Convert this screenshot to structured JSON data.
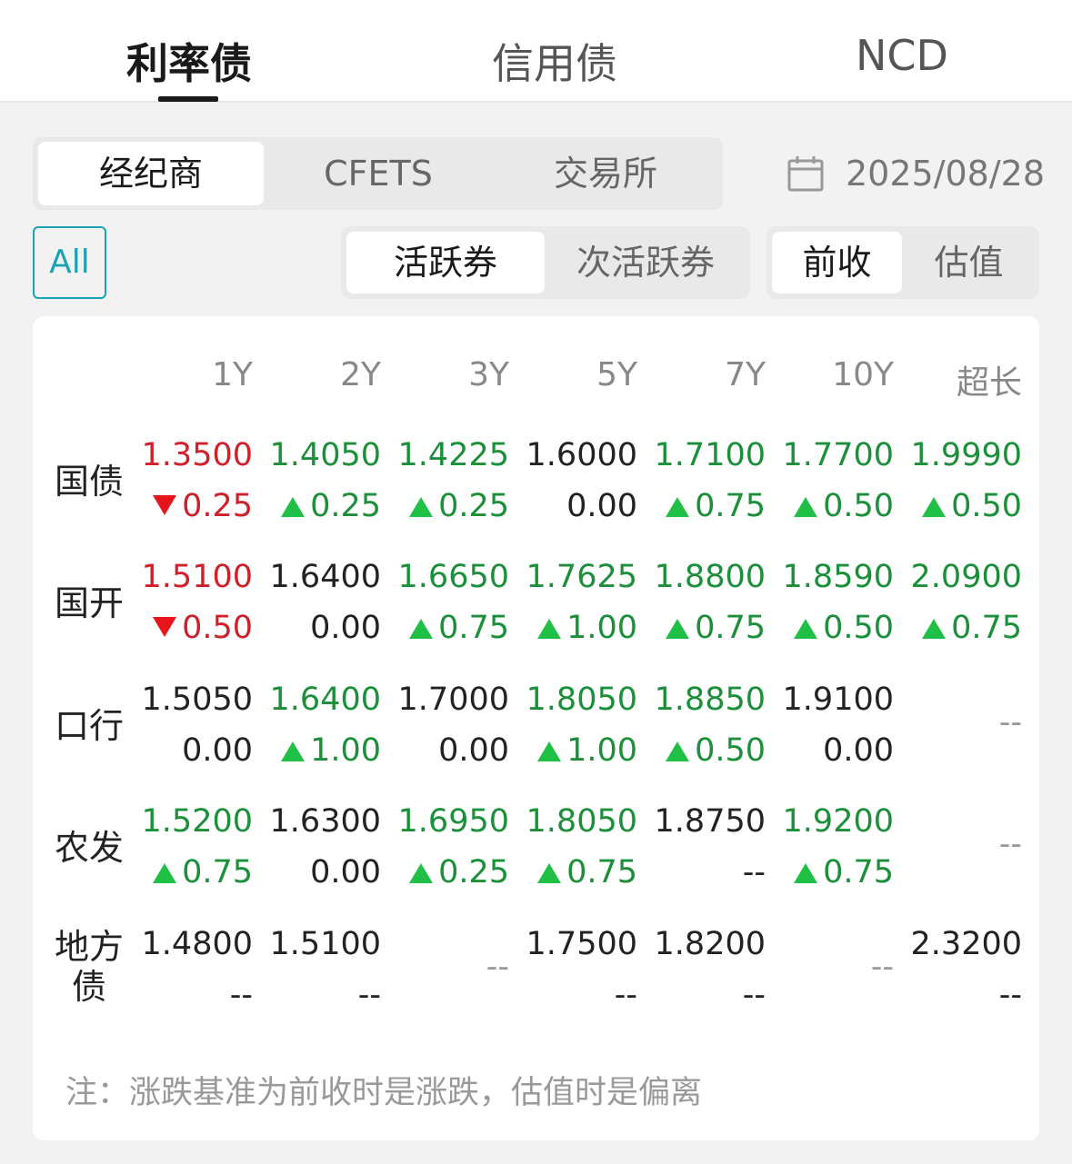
{
  "top_tabs": [
    {
      "label": "利率债",
      "active": true
    },
    {
      "label": "信用债",
      "active": false
    },
    {
      "label": "NCD",
      "active": false
    }
  ],
  "source_tabs": [
    {
      "label": "经纪商",
      "active": true
    },
    {
      "label": "CFETS",
      "active": false
    },
    {
      "label": "交易所",
      "active": false
    }
  ],
  "date": "2025/08/28",
  "all_label": "All",
  "bond_tabs": [
    {
      "label": "活跃券",
      "active": true
    },
    {
      "label": "次活跃券",
      "active": false
    }
  ],
  "basis_tabs": [
    {
      "label": "前收",
      "active": true
    },
    {
      "label": "估值",
      "active": false
    }
  ],
  "columns": [
    "1Y",
    "2Y",
    "3Y",
    "5Y",
    "7Y",
    "10Y",
    "超长"
  ],
  "rows": [
    {
      "label": "国债",
      "cells": [
        {
          "value": "1.3500",
          "change": "0.25",
          "dir": "down"
        },
        {
          "value": "1.4050",
          "change": "0.25",
          "dir": "up"
        },
        {
          "value": "1.4225",
          "change": "0.25",
          "dir": "up"
        },
        {
          "value": "1.6000",
          "change": "0.00",
          "dir": "flat"
        },
        {
          "value": "1.7100",
          "change": "0.75",
          "dir": "up"
        },
        {
          "value": "1.7700",
          "change": "0.50",
          "dir": "up"
        },
        {
          "value": "1.9990",
          "change": "0.50",
          "dir": "up"
        }
      ]
    },
    {
      "label": "国开",
      "cells": [
        {
          "value": "1.5100",
          "change": "0.50",
          "dir": "down"
        },
        {
          "value": "1.6400",
          "change": "0.00",
          "dir": "flat"
        },
        {
          "value": "1.6650",
          "change": "0.75",
          "dir": "up"
        },
        {
          "value": "1.7625",
          "change": "1.00",
          "dir": "up"
        },
        {
          "value": "1.8800",
          "change": "0.75",
          "dir": "up"
        },
        {
          "value": "1.8590",
          "change": "0.50",
          "dir": "up"
        },
        {
          "value": "2.0900",
          "change": "0.75",
          "dir": "up"
        }
      ]
    },
    {
      "label": "口行",
      "cells": [
        {
          "value": "1.5050",
          "change": "0.00",
          "dir": "flat"
        },
        {
          "value": "1.6400",
          "change": "1.00",
          "dir": "up"
        },
        {
          "value": "1.7000",
          "change": "0.00",
          "dir": "flat"
        },
        {
          "value": "1.8050",
          "change": "1.00",
          "dir": "up"
        },
        {
          "value": "1.8850",
          "change": "0.50",
          "dir": "up"
        },
        {
          "value": "1.9100",
          "change": "0.00",
          "dir": "flat"
        },
        {
          "empty": true,
          "text": "--"
        }
      ]
    },
    {
      "label": "农发",
      "cells": [
        {
          "value": "1.5200",
          "change": "0.75",
          "dir": "up"
        },
        {
          "value": "1.6300",
          "change": "0.00",
          "dir": "flat"
        },
        {
          "value": "1.6950",
          "change": "0.25",
          "dir": "up"
        },
        {
          "value": "1.8050",
          "change": "0.75",
          "dir": "up"
        },
        {
          "value": "1.8750",
          "change": "--",
          "dir": "none"
        },
        {
          "value": "1.9200",
          "change": "0.75",
          "dir": "up"
        },
        {
          "empty": true,
          "text": "--"
        }
      ]
    },
    {
      "label": "地方债",
      "cells": [
        {
          "value": "1.4800",
          "change": "--",
          "dir": "none"
        },
        {
          "value": "1.5100",
          "change": "--",
          "dir": "none"
        },
        {
          "empty": true,
          "text": "--"
        },
        {
          "value": "1.7500",
          "change": "--",
          "dir": "none"
        },
        {
          "value": "1.8200",
          "change": "--",
          "dir": "none"
        },
        {
          "empty": true,
          "text": "--"
        },
        {
          "value": "2.3200",
          "change": "--",
          "dir": "none"
        }
      ]
    }
  ],
  "note": "注：涨跌基准为前收时是涨跌，估值时是偏离",
  "colors": {
    "up": "#20c047",
    "down": "#e8141b",
    "accent": "#1aa3b5"
  }
}
